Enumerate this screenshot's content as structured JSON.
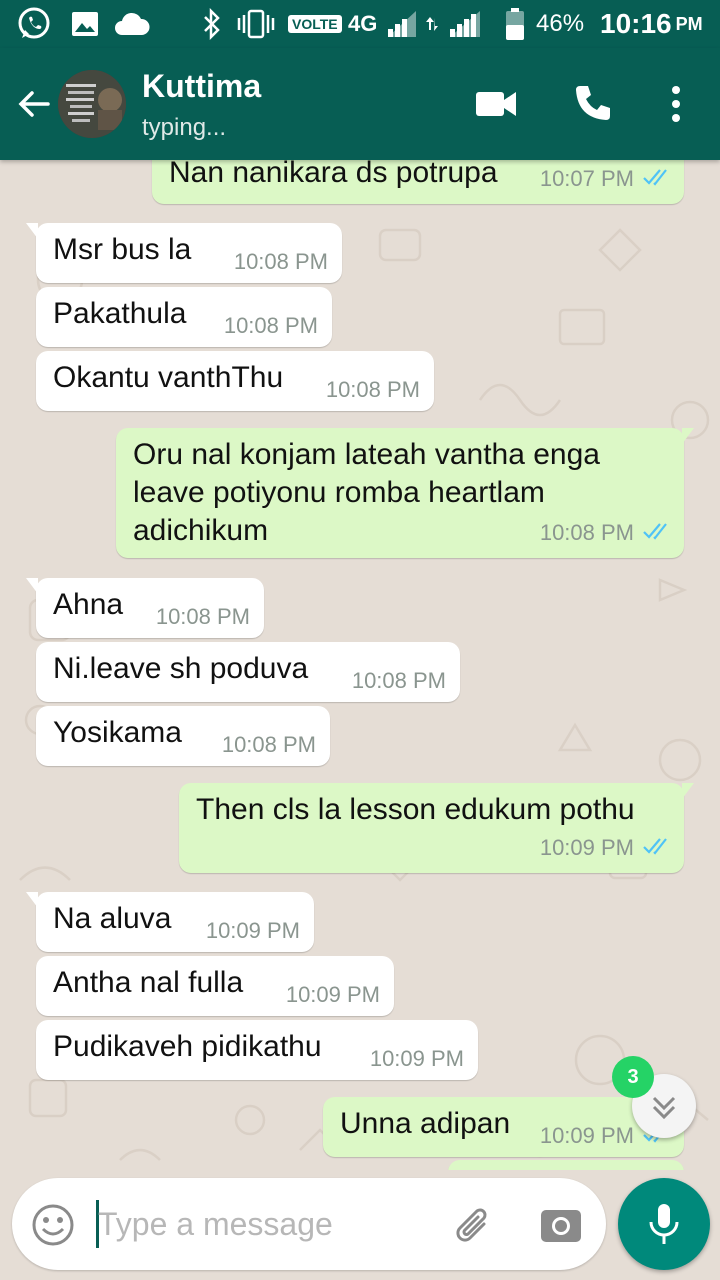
{
  "status_bar": {
    "volte": "VOLTE",
    "network": "4G",
    "battery": "46%",
    "time": "10:16",
    "ampm": "PM",
    "icons": [
      "whatsapp-icon",
      "gallery-icon",
      "cloud-icon",
      "bluetooth-icon",
      "vibrate-icon",
      "signal-icon",
      "battery-icon"
    ]
  },
  "header": {
    "contact_name": "Kuttima",
    "status": "typing..."
  },
  "messages": [
    {
      "text": "Nan nanikara ds potrupa",
      "time": "10:07 PM",
      "direction": "out",
      "ticks": "read"
    },
    {
      "text": "Msr bus la",
      "time": "10:08 PM",
      "direction": "in"
    },
    {
      "text": "Pakathula",
      "time": "10:08 PM",
      "direction": "in"
    },
    {
      "text": "Okantu vanthThu",
      "time": "10:08 PM",
      "direction": "in"
    },
    {
      "lines": [
        "Oru nal konjam lateah vantha enga",
        "leave potiyonu romba heartlam",
        "adichikum"
      ],
      "time": "10:08 PM",
      "direction": "out",
      "ticks": "read"
    },
    {
      "text": "Ahna",
      "time": "10:08 PM",
      "direction": "in"
    },
    {
      "text": "Ni.leave sh poduva",
      "time": "10:08 PM",
      "direction": "in"
    },
    {
      "text": "Yosikama",
      "time": "10:08 PM",
      "direction": "in"
    },
    {
      "text": "Then cls la lesson edukum pothu",
      "time": "10:09 PM",
      "direction": "out",
      "ticks": "read"
    },
    {
      "text": "Na aluva",
      "time": "10:09 PM",
      "direction": "in"
    },
    {
      "text": "Antha nal fulla",
      "time": "10:09 PM",
      "direction": "in"
    },
    {
      "text": "Pudikaveh pidikathu",
      "time": "10:09 PM",
      "direction": "in"
    },
    {
      "text": "Unna adipan",
      "time": "10:09 PM",
      "direction": "out",
      "ticks": "read"
    }
  ],
  "scroll_down": {
    "unread_count": "3"
  },
  "composer": {
    "placeholder": "Type a message"
  },
  "colors": {
    "header": "#075e54",
    "outgoing_bubble": "#dcf8c6",
    "incoming_bubble": "#ffffff",
    "wallpaper": "#e5ddd5",
    "read_ticks": "#4fc3f7",
    "fab": "#00897b",
    "badge": "#25d366"
  }
}
